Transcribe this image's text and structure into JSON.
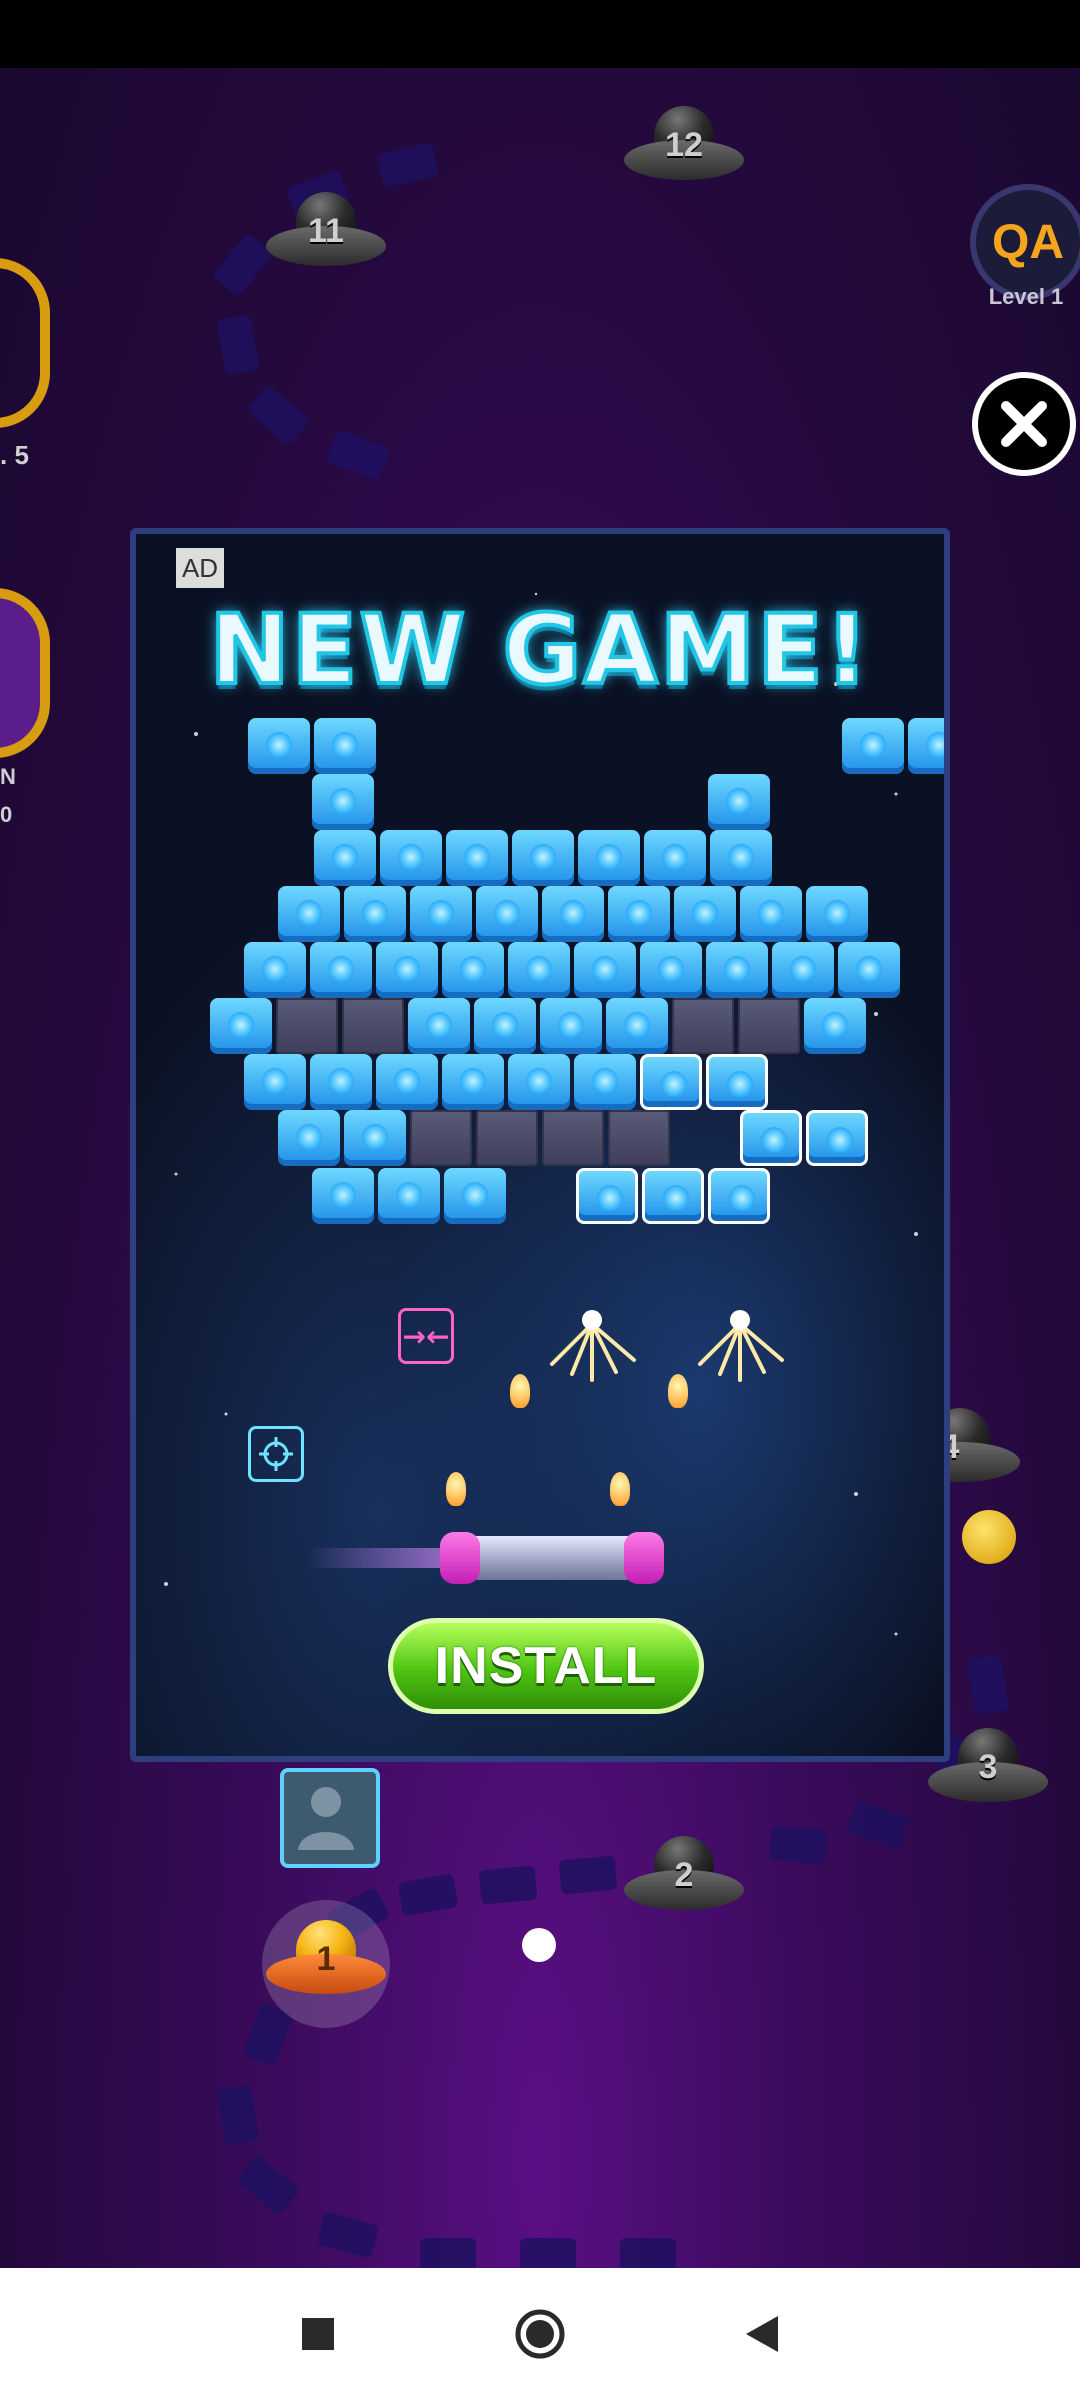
{
  "map": {
    "nodes": [
      {
        "label": "12"
      },
      {
        "label": "11"
      },
      {
        "label": "4"
      },
      {
        "label": "3"
      },
      {
        "label": "2"
      },
      {
        "label": "1"
      }
    ],
    "left_partial_texts": [
      ". 5",
      "N",
      "0"
    ]
  },
  "profile": {
    "initials": "QA",
    "level": "Level 1"
  },
  "close_icon": "close-icon",
  "ad": {
    "label": "AD",
    "title": "NEW GAME!",
    "install_label": "INSTALL",
    "power_icons": [
      "shrink-arrows-icon",
      "crosshair-icon"
    ]
  },
  "colors": {
    "background_purple": "#3a0b5c",
    "install_green": "#4fc413",
    "brick_blue": "#1d8fe8",
    "avatar_text": "#f4a51c"
  },
  "navigation_bar": {
    "icons": [
      "recent-apps-icon",
      "home-icon",
      "back-icon"
    ]
  }
}
